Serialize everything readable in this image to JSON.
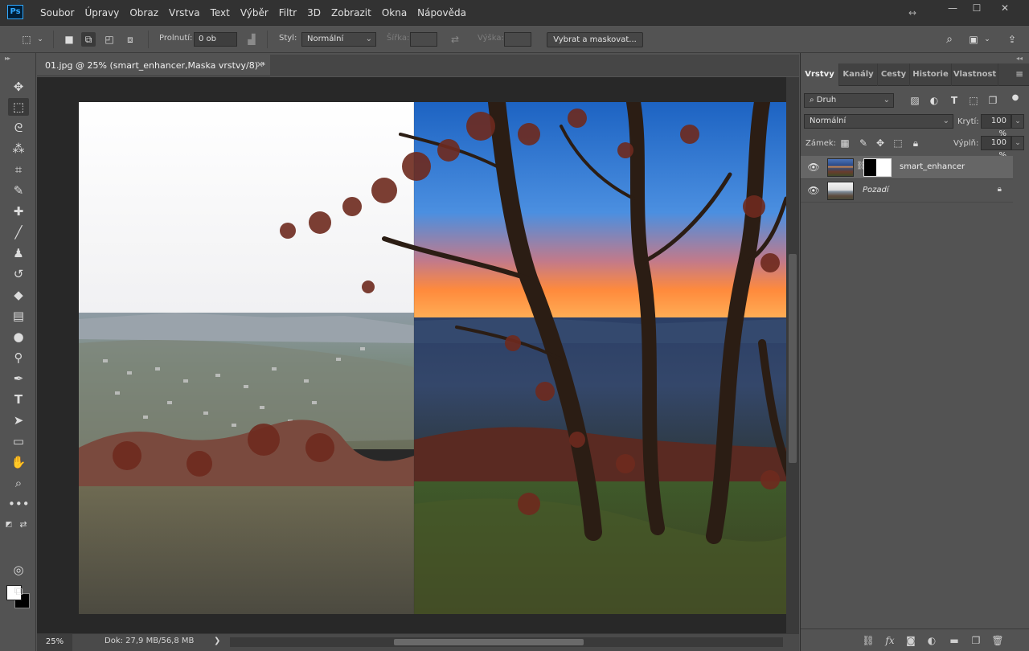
{
  "app": {
    "logo": "Ps",
    "menu": [
      "Soubor",
      "Úpravy",
      "Obraz",
      "Vrstva",
      "Text",
      "Výběr",
      "Filtr",
      "3D",
      "Zobrazit",
      "Okna",
      "Nápověda"
    ],
    "window_controls": [
      "minimize-icon",
      "maximize-icon",
      "close-icon"
    ]
  },
  "options_bar": {
    "feather_label": "Prolnutí:",
    "feather_value": "0 ob",
    "style_label": "Styl:",
    "style_value": "Normální",
    "width_label": "Šířka:",
    "height_label": "Výška:",
    "select_mask_label": "Vybrat a maskovat..."
  },
  "document": {
    "tab_title": "01.jpg @ 25% (smart_enhancer,Maska vrstvy/8) *",
    "zoom": "25%",
    "doc_info": "Dok: 27,9 MB/56,8 MB",
    "status_arrow": "❯"
  },
  "toolbox": {
    "foreground_color": "#ffffff",
    "background_color": "#000000"
  },
  "layers_panel": {
    "tabs": [
      "Vrstvy",
      "Kanály",
      "Cesty",
      "Historie",
      "Vlastnost"
    ],
    "active_tab": "Vrstvy",
    "filter_value": "Druh",
    "blend_mode": "Normální",
    "opacity_label": "Krytí:",
    "opacity_value": "100 %",
    "lock_label": "Zámek:",
    "fill_label": "Výplň:",
    "fill_value": "100 %",
    "layers": [
      {
        "name": "smart_enhancer",
        "selected": true,
        "has_mask": true
      },
      {
        "name": "Pozadí",
        "selected": false,
        "locked": true
      }
    ]
  }
}
